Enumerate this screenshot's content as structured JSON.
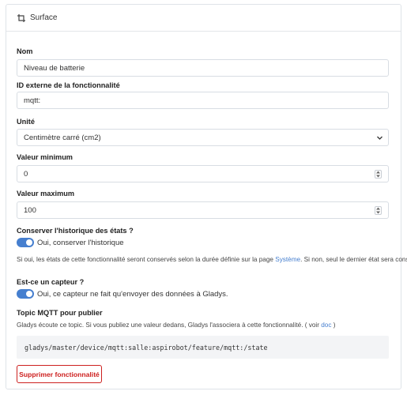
{
  "header": {
    "title": "Surface",
    "icon": "crop-icon"
  },
  "fields": {
    "name": {
      "label": "Nom",
      "value": "Niveau de batterie"
    },
    "external_id": {
      "label": "ID externe de la fonctionnalité",
      "value": "mqtt:"
    },
    "unit": {
      "label": "Unité",
      "value": "Centimètre carré (cm2)"
    },
    "min": {
      "label": "Valeur minimum",
      "value": "0"
    },
    "max": {
      "label": "Valeur maximum",
      "value": "100"
    }
  },
  "history": {
    "label": "Conserver l'historique des états ?",
    "toggle_label": "Oui, conserver l'historique",
    "toggle_on": true,
    "help_prefix": "Si oui, les états de cette fonctionnalité seront conservés selon la durée définie sur la page ",
    "help_link": "Système",
    "help_suffix": ". Si non, seul le dernier état sera conservé."
  },
  "sensor": {
    "label": "Est-ce un capteur ?",
    "toggle_label": "Oui, ce capteur ne fait qu'envoyer des données à Gladys.",
    "toggle_on": true
  },
  "mqtt": {
    "label": "Topic MQTT pour publier",
    "help_prefix": "Gladys écoute ce topic. Si vous publiez une valeur dedans, Gladys l'associera à cette fonctionnalité. ( voir ",
    "help_link": "doc",
    "help_suffix": " )",
    "topic": "gladys/master/device/mqtt:salle:aspirobot/feature/mqtt:/state"
  },
  "delete_button": "Supprimer fonctionnalité",
  "colors": {
    "accent": "#467fcf",
    "danger": "#cd201f"
  }
}
